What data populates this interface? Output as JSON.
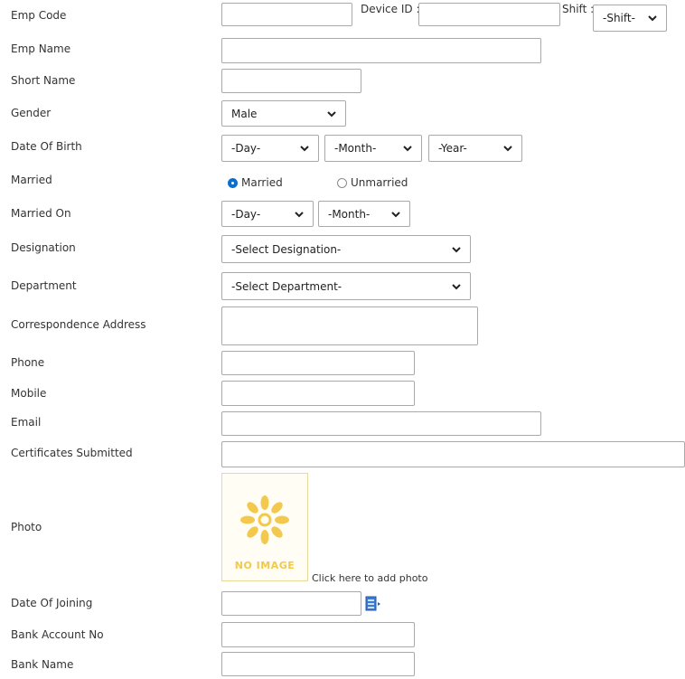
{
  "fields": {
    "emp_code": {
      "label": "Emp Code",
      "value": ""
    },
    "device_id": {
      "label": "Device ID :",
      "value": ""
    },
    "shift": {
      "label": "Shift :",
      "selected": "-Shift-"
    },
    "emp_name": {
      "label": "Emp Name",
      "value": ""
    },
    "short_name": {
      "label": "Short Name",
      "value": ""
    },
    "gender": {
      "label": "Gender",
      "selected": "Male"
    },
    "dob": {
      "label": "Date Of Birth",
      "day": "-Day-",
      "month": "-Month-",
      "year": "-Year-"
    },
    "married": {
      "label": "Married",
      "options": [
        "Married",
        "Unmarried"
      ],
      "selected": "Married"
    },
    "married_on": {
      "label": "Married On",
      "day": "-Day-",
      "month": "-Month-"
    },
    "designation": {
      "label": "Designation",
      "selected": "-Select Designation-"
    },
    "department": {
      "label": "Department",
      "selected": "-Select Department-"
    },
    "address": {
      "label": "Correspondence Address",
      "value": ""
    },
    "phone": {
      "label": "Phone",
      "value": ""
    },
    "mobile": {
      "label": "Mobile",
      "value": ""
    },
    "email": {
      "label": "Email",
      "value": ""
    },
    "certificates": {
      "label": "Certificates Submitted",
      "value": ""
    },
    "photo": {
      "label": "Photo",
      "placeholder_text": "NO IMAGE",
      "add_link": "Click here to add photo"
    },
    "date_of_joining": {
      "label": "Date Of Joining",
      "value": ""
    },
    "bank_account": {
      "label": "Bank Account No",
      "value": ""
    },
    "bank_name": {
      "label": "Bank Name",
      "value": ""
    }
  },
  "colors": {
    "radio_selected": "#0a6ed1",
    "no_image_accent": "#f2c94c",
    "calendar_icon": "#3a7bd5"
  },
  "icons": {
    "select_arrow": "chevron-down-icon",
    "calendar": "calendar-icon",
    "no_image": "flower-placeholder-icon"
  }
}
